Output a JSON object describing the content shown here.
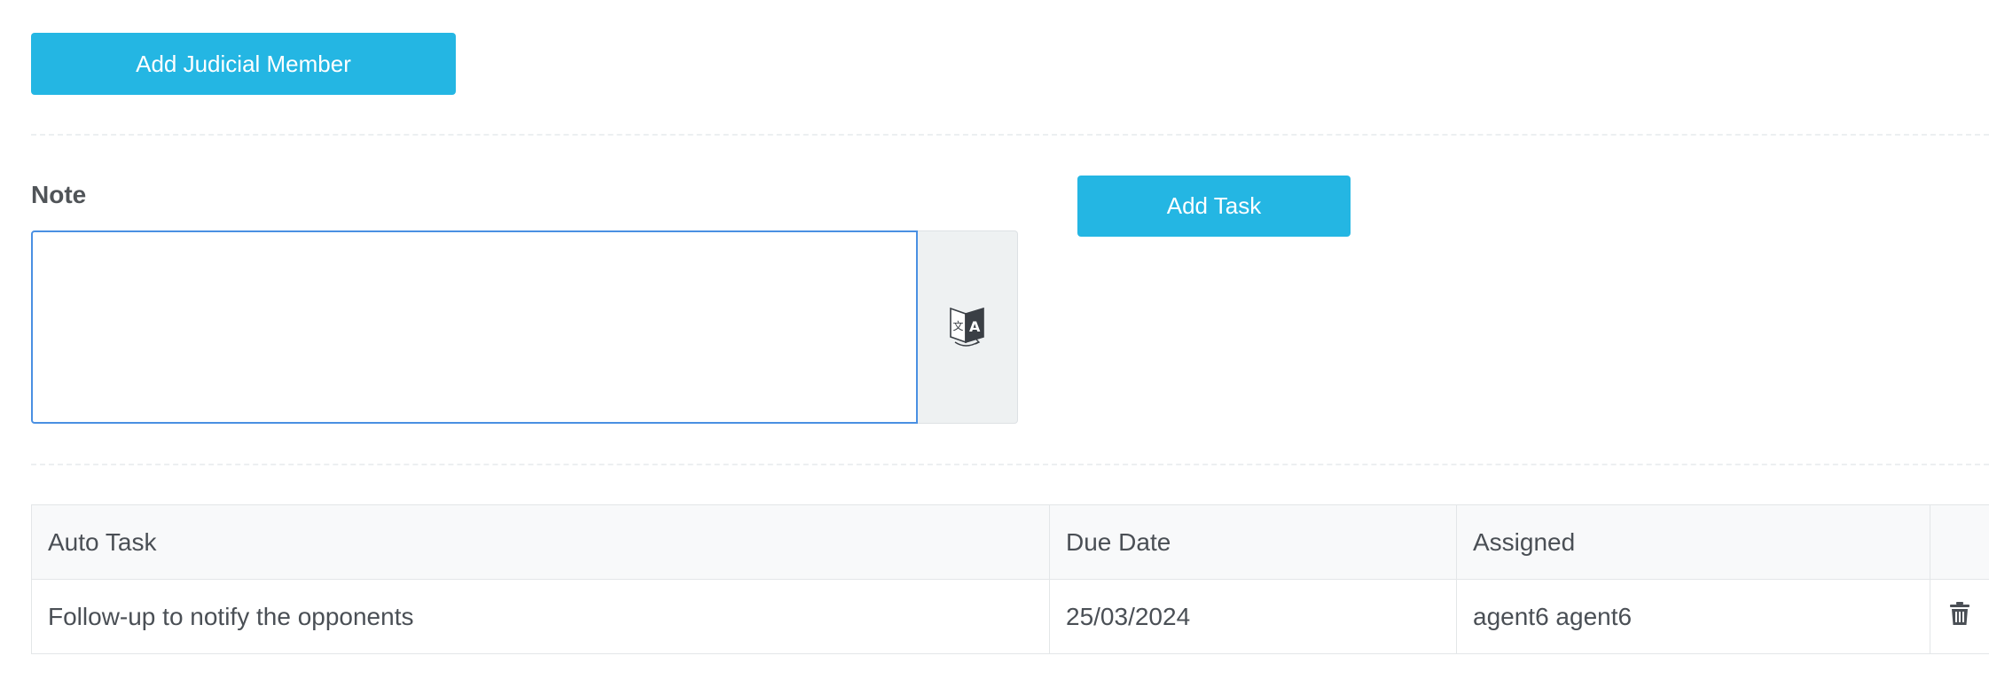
{
  "actions": {
    "add_judicial_member_label": "Add Judicial Member",
    "add_task_label": "Add Task"
  },
  "note": {
    "label": "Note",
    "value": "",
    "translate_icon": "translate-icon"
  },
  "tasks_table": {
    "columns": [
      "Auto Task",
      "Due Date",
      "Assigned",
      ""
    ],
    "rows": [
      {
        "auto_task": "Follow-up to notify the opponents",
        "due_date": "25/03/2024",
        "assigned": "agent6 agent6",
        "action_icon": "trash-icon"
      }
    ]
  },
  "colors": {
    "primary_button": "#24b6e3",
    "focus_border": "#4a90e2",
    "table_header_bg": "#f8f9fa"
  }
}
